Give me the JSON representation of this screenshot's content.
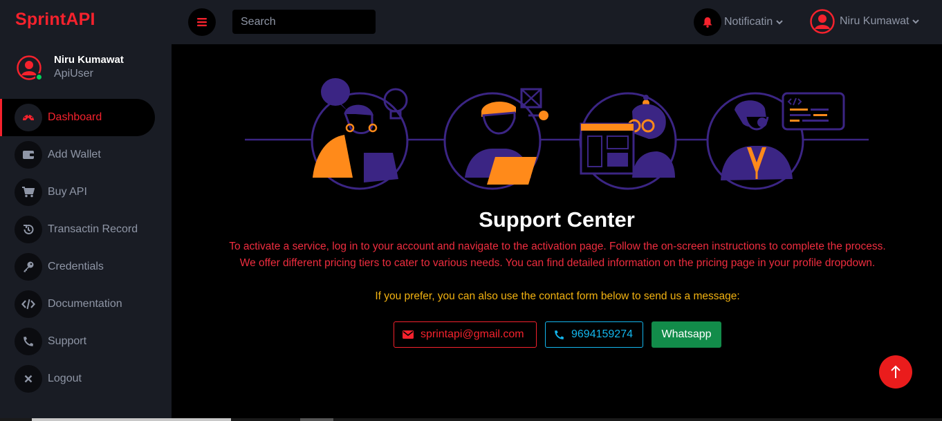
{
  "brand": "SprintAPI",
  "profile": {
    "name": "Niru Kumawat",
    "role": "ApiUser"
  },
  "sidebar": {
    "items": [
      {
        "label": "Dashboard",
        "icon": "dashboard-gauge-icon",
        "active": true
      },
      {
        "label": "Add Wallet",
        "icon": "wallet-icon"
      },
      {
        "label": "Buy API",
        "icon": "cart-icon"
      },
      {
        "label": "Transactin Record",
        "icon": "history-icon"
      },
      {
        "label": "Credentials",
        "icon": "key-icon"
      },
      {
        "label": "Documentation",
        "icon": "code-icon"
      },
      {
        "label": "Support",
        "icon": "phone-icon"
      },
      {
        "label": "Logout",
        "icon": "close-icon"
      }
    ]
  },
  "topbar": {
    "search_placeholder": "Search",
    "notifications_label": "Notificatin",
    "user_name": "Niru Kumawat"
  },
  "main": {
    "title": "Support Center",
    "paragraph1": "To activate a service, log in to your account and navigate to the activation page. Follow the on-screen instructions to complete the process.",
    "paragraph2": "We offer different pricing tiers to cater to various needs. You can find detailed information on the pricing page in your profile dropdown.",
    "paragraph3": "If you prefer, you can also use the contact form below to send us a message:",
    "contacts": {
      "email": "sprintapi@gmail.com",
      "phone": "9694159274",
      "whatsapp": "Whatsapp"
    }
  },
  "colors": {
    "accent": "#f5222d",
    "sidebar_bg": "#191c24",
    "muted_text": "#8f96a6",
    "warning_text": "#f2b211",
    "info": "#13b7ef",
    "success": "#128c4a",
    "illustration_purple": "#3b2584",
    "illustration_orange": "#ff8a1a"
  }
}
